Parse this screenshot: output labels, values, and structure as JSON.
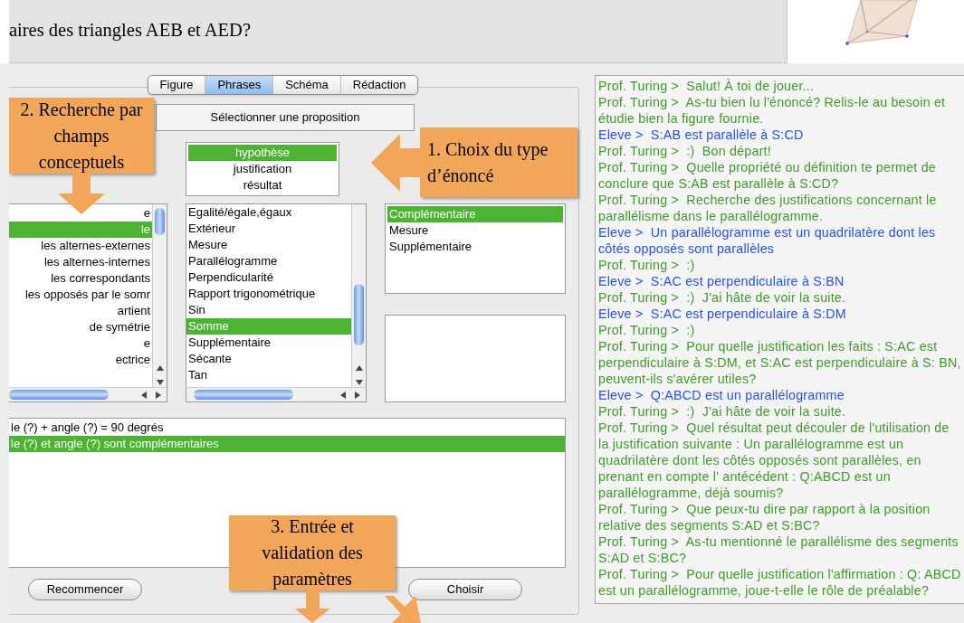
{
  "problem": {
    "text": "aires des triangles AEB et AED?"
  },
  "tabs": [
    {
      "label": "Figure",
      "selected": false
    },
    {
      "label": "Phrases",
      "selected": true
    },
    {
      "label": "Schéma",
      "selected": false
    },
    {
      "label": "Rédaction",
      "selected": false
    }
  ],
  "select_button": "Sélectionner une proposition",
  "statement_types": [
    {
      "label": "hypothèse",
      "selected": true
    },
    {
      "label": "justification",
      "selected": false
    },
    {
      "label": "résultat",
      "selected": false
    }
  ],
  "fields_list": [
    {
      "label": "e",
      "selected": false
    },
    {
      "label": "le",
      "selected": true
    },
    {
      "label": "les alternes-externes",
      "selected": false
    },
    {
      "label": "les alternes-internes",
      "selected": false
    },
    {
      "label": "les correspondants",
      "selected": false
    },
    {
      "label": "les opposés par le somr",
      "selected": false
    },
    {
      "label": "artient",
      "selected": false
    },
    {
      "label": "de symétrie",
      "selected": false
    },
    {
      "label": "e",
      "selected": false
    },
    {
      "label": "ectrice",
      "selected": false
    }
  ],
  "concepts_list": [
    {
      "label": "Egalité/égale,égaux",
      "selected": false
    },
    {
      "label": "Extérieur",
      "selected": false
    },
    {
      "label": "Mesure",
      "selected": false
    },
    {
      "label": "Parallélogramme",
      "selected": false
    },
    {
      "label": "Perpendicularité",
      "selected": false
    },
    {
      "label": "Rapport trigonométrique",
      "selected": false
    },
    {
      "label": "Sin",
      "selected": false
    },
    {
      "label": "Somme",
      "selected": true
    },
    {
      "label": "Supplémentaire",
      "selected": false
    },
    {
      "label": "Sécante",
      "selected": false
    },
    {
      "label": "Tan",
      "selected": false
    }
  ],
  "relations_list": [
    {
      "label": "Complémentaire",
      "selected": true
    },
    {
      "label": "Mesure",
      "selected": false
    },
    {
      "label": "Supplémentaire",
      "selected": false
    }
  ],
  "sentences_list": [
    {
      "label": "le (?) + angle (?) = 90 degrés",
      "selected": false
    },
    {
      "label": "le (?) et angle (?) sont complémentaires",
      "selected": true
    }
  ],
  "buttons": [
    {
      "label": "Recommencer"
    },
    {
      "label": "Choisir"
    }
  ],
  "chat": [
    {
      "kind": "tutor",
      "speaker": "Prof. Turing >",
      "text": "Salut! À toi de jouer..."
    },
    {
      "kind": "tutor",
      "speaker": "Prof. Turing >",
      "text": "As-tu bien lu l'énoncé? Relis-le au besoin et étudie bien la figure fournie."
    },
    {
      "kind": "student",
      "speaker": "Eleve >",
      "text": "S:AB est parallèle à S:CD"
    },
    {
      "kind": "tutor",
      "speaker": "Prof. Turing >",
      "text": ":)  Bon départ!"
    },
    {
      "kind": "tutor",
      "speaker": "Prof. Turing >",
      "text": "Quelle propriété ou définition te permet de conclure que S:AB est parallèle à S:CD?"
    },
    {
      "kind": "tutor",
      "speaker": "Prof. Turing >",
      "text": "Recherche des justifications concernant le parallélisme dans le parallélogramme."
    },
    {
      "kind": "student",
      "speaker": "Eleve >",
      "text": "Un parallélogramme est un quadrilatère dont les côtés opposés sont parallèles"
    },
    {
      "kind": "tutor",
      "speaker": "Prof. Turing >",
      "text": ":)"
    },
    {
      "kind": "student",
      "speaker": "Eleve >",
      "text": "S:AC est perpendiculaire à S:BN"
    },
    {
      "kind": "tutor",
      "speaker": "Prof. Turing >",
      "text": ":)  J'ai hâte de voir la suite."
    },
    {
      "kind": "student",
      "speaker": "Eleve >",
      "text": "S:AC est perpendiculaire à S:DM"
    },
    {
      "kind": "tutor",
      "speaker": "Prof. Turing >",
      "text": ":)"
    },
    {
      "kind": "tutor",
      "speaker": "Prof. Turing >",
      "text": "Pour quelle justification les faits : S:AC est perpendiculaire à S:DM, et S:AC est perpendiculaire à S: BN, peuvent-ils s'avérer utiles?"
    },
    {
      "kind": "student",
      "speaker": "Eleve >",
      "text": "Q:ABCD est un parallélogramme"
    },
    {
      "kind": "tutor",
      "speaker": "Prof. Turing >",
      "text": ":)  J'ai hâte de voir la suite."
    },
    {
      "kind": "tutor",
      "speaker": "Prof. Turing >",
      "text": "Quel résultat peut découler de l'utilisation de la justification suivante : Un parallélogramme est un quadrilatère dont les côtés opposés sont parallèles, en prenant en compte l' antécédent : Q:ABCD est un parallélogramme, déjà soumis?"
    },
    {
      "kind": "tutor",
      "speaker": "Prof. Turing >",
      "text": "Que peux-tu dire par rapport à la position relative des segments S:AD et S:BC?"
    },
    {
      "kind": "tutor",
      "speaker": "Prof. Turing >",
      "text": "As-tu mentionné le parallélisme des segments S:AD et S:BC?"
    },
    {
      "kind": "tutor",
      "speaker": "Prof. Turing >",
      "text": "Pour quelle justification l'affirmation : Q: ABCD est un parallélogramme, joue-t-elle le rôle de préalable?"
    }
  ],
  "callouts": [
    {
      "kind": "left",
      "text": "1. Choix du type d’énoncé"
    },
    {
      "kind": "down",
      "text": "2. Recherche par champs conceptuels"
    },
    {
      "kind": "double",
      "text": "3. Entrée et validation des paramètres"
    }
  ]
}
